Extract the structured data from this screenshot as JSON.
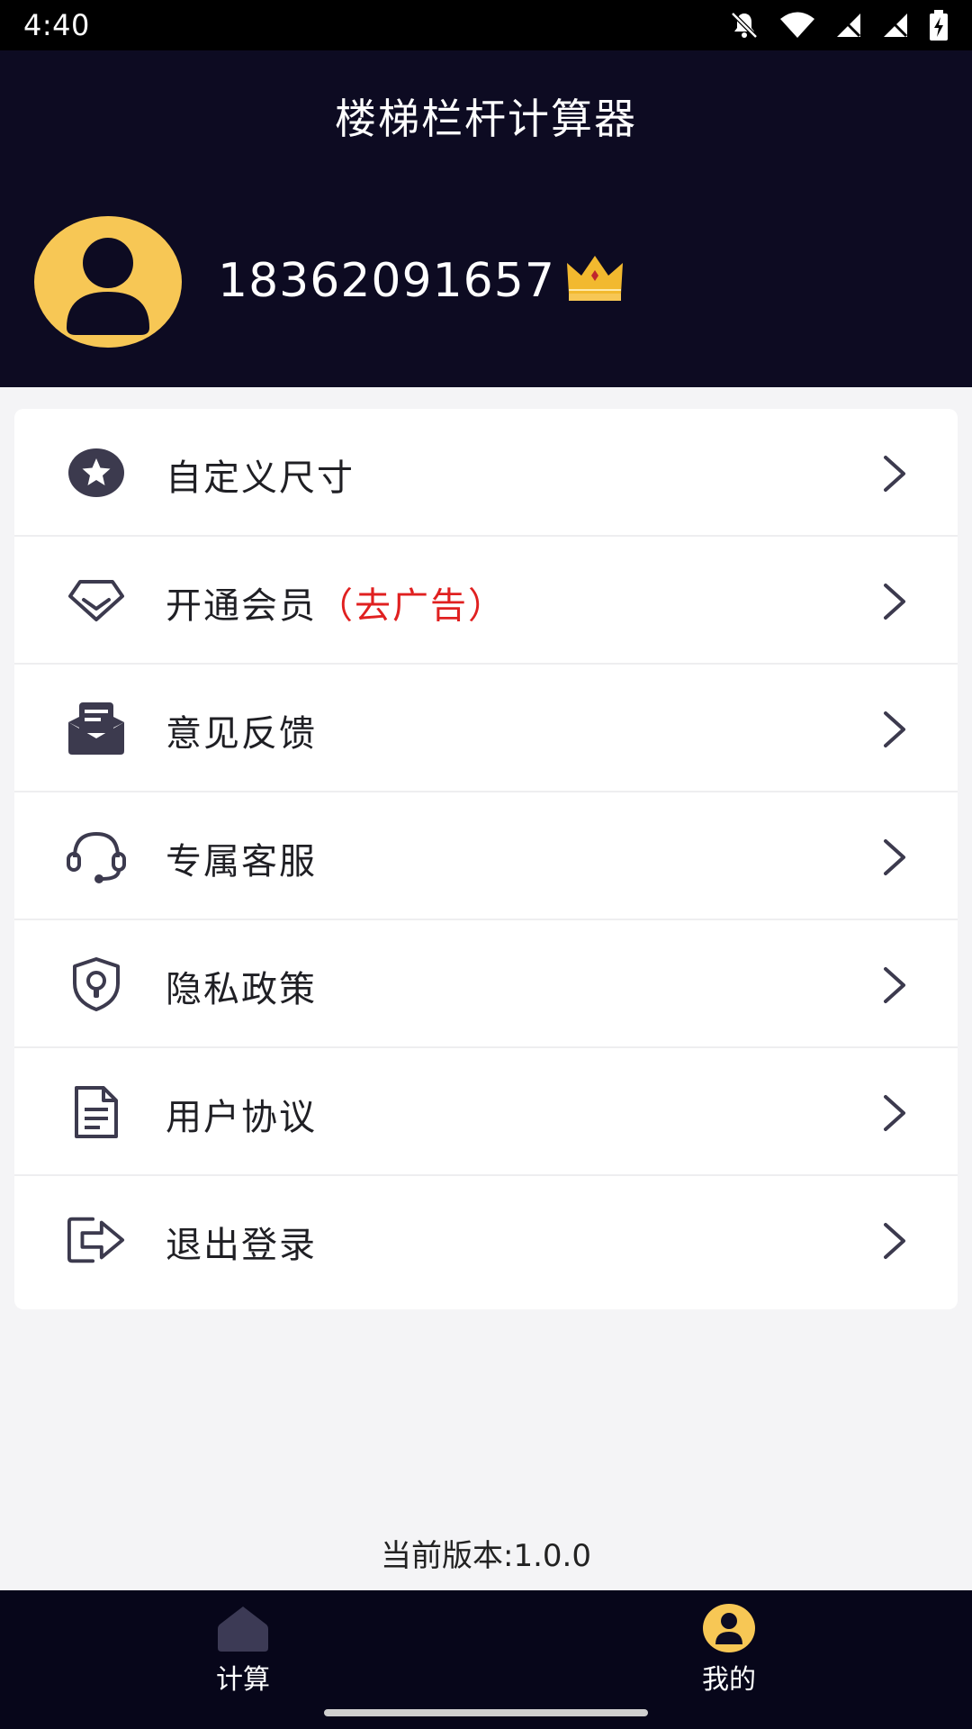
{
  "status_bar": {
    "time": "4:40"
  },
  "header": {
    "title": "楼梯栏杆计算器",
    "username": "18362091657"
  },
  "menu": {
    "items": [
      {
        "label": "自定义尺寸",
        "icon": "star-badge-icon"
      },
      {
        "label": "开通会员",
        "note": "（去广告）",
        "icon": "diamond-icon"
      },
      {
        "label": "意见反馈",
        "icon": "mail-icon"
      },
      {
        "label": "专属客服",
        "icon": "headset-icon"
      },
      {
        "label": "隐私政策",
        "icon": "shield-lock-icon"
      },
      {
        "label": "用户协议",
        "icon": "document-icon"
      },
      {
        "label": "退出登录",
        "icon": "logout-icon"
      }
    ]
  },
  "footer": {
    "version": "当前版本:1.0.0"
  },
  "tabbar": {
    "tabs": [
      {
        "label": "计算",
        "icon": "home-icon",
        "active": false
      },
      {
        "label": "我的",
        "icon": "user-icon",
        "active": true
      }
    ]
  },
  "colors": {
    "header_bg": "#0d0b22",
    "avatar_bg": "#f7c755",
    "accent_red": "#e02020",
    "icon_dark": "#3c3a4e",
    "tabbar_bg": "#07061a"
  }
}
